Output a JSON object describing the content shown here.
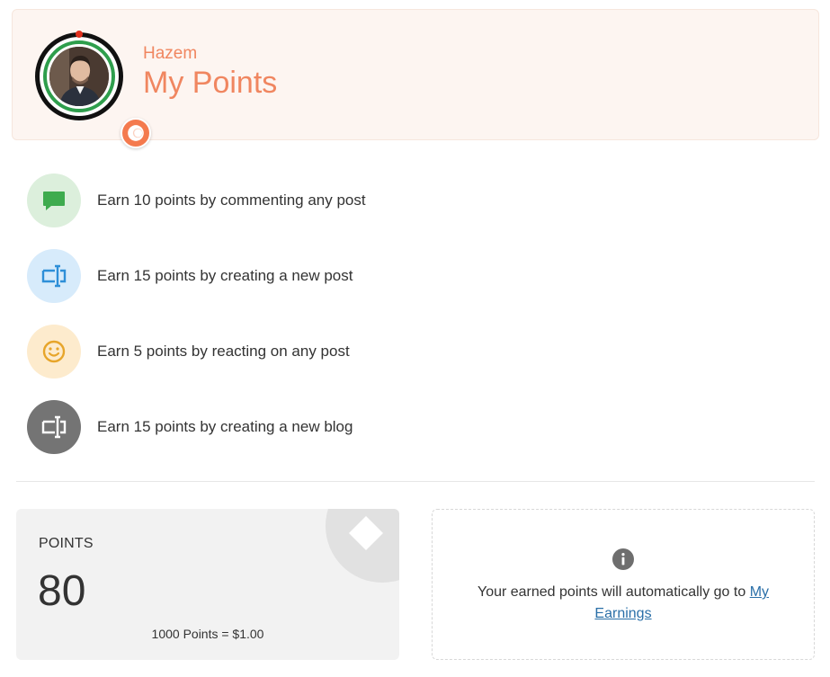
{
  "header": {
    "user_name": "Hazem",
    "title": "My Points"
  },
  "earn_items": [
    {
      "label": "Earn 10 points by commenting any post",
      "icon": "comment-icon",
      "bg": "#dcefdc",
      "fg": "#3eab4e"
    },
    {
      "label": "Earn 15 points by creating a new post",
      "icon": "text-cursor-icon",
      "bg": "#d7ebfb",
      "fg": "#2e8fd8"
    },
    {
      "label": "Earn 5 points by reacting on any post",
      "icon": "smiley-icon",
      "bg": "#fdebcd",
      "fg": "#e7a52a"
    },
    {
      "label": "Earn 15 points by creating a new blog",
      "icon": "text-cursor-icon",
      "bg": "#747474",
      "fg": "#ffffff"
    }
  ],
  "points_card": {
    "heading": "POINTS",
    "value": "80",
    "rate": "1000 Points = $1.00"
  },
  "info_card": {
    "text": "Your earned points will automatically go to",
    "link_label": "My Earnings"
  },
  "colors": {
    "accent": "#f08660",
    "badge": "#f47a4e",
    "link": "#2a6fa8"
  }
}
